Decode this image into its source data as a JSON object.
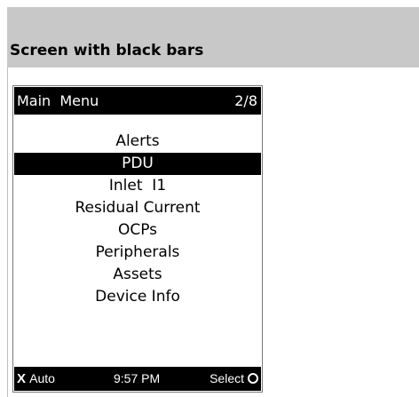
{
  "section": {
    "title": "Screen with black bars"
  },
  "screen": {
    "topbar": {
      "title": "Main  Menu",
      "page_indicator": "2/8"
    },
    "menu": {
      "items": [
        {
          "label": "Alerts",
          "selected": false
        },
        {
          "label": "PDU",
          "selected": true
        },
        {
          "label": "Inlet  I1",
          "selected": false
        },
        {
          "label": "Residual Current",
          "selected": false
        },
        {
          "label": "OCPs",
          "selected": false
        },
        {
          "label": "Peripherals",
          "selected": false
        },
        {
          "label": "Assets",
          "selected": false
        },
        {
          "label": "Device Info",
          "selected": false
        }
      ]
    },
    "bottombar": {
      "left_glyph": "X",
      "left_label": "Auto",
      "time": "9:57 PM",
      "right_label": "Select",
      "right_icon": "circle-icon"
    }
  },
  "colors": {
    "header_band": "#c8c8c8",
    "bar_background": "#000000",
    "bar_text": "#ffffff",
    "screen_border": "#7a7a7a"
  }
}
